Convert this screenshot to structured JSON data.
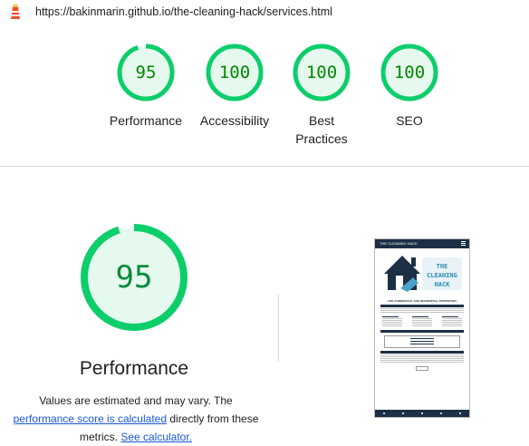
{
  "url": "https://bakinmarin.github.io/the-cleaning-hack/services.html",
  "colors": {
    "pass_green": "#0cce6b",
    "pass_fill": "#e6f9ee",
    "score_text": "#008800",
    "link": "#1a56d6"
  },
  "categories": [
    {
      "label": "Performance",
      "score": 95
    },
    {
      "label": "Accessibility",
      "score": 100
    },
    {
      "label": "Best Practices",
      "score": 100
    },
    {
      "label": "SEO",
      "score": 100
    }
  ],
  "main": {
    "score": 95,
    "title": "Performance",
    "desc_prefix": "Values are estimated and may vary. The ",
    "desc_link1": "performance score is calculated",
    "desc_middle": " directly from these metrics. ",
    "desc_link2": "See calculator."
  },
  "thumbnail": {
    "nav_title": "THE CLEANING HACK",
    "logo_text": "THE CLEANING HACK",
    "tagline": "FOR COMMERCIAL AND RESIDENTIAL PROPERTIES",
    "section1": "What We Offer",
    "section2": "Where We Cover",
    "section3": "What We Guarantee"
  }
}
